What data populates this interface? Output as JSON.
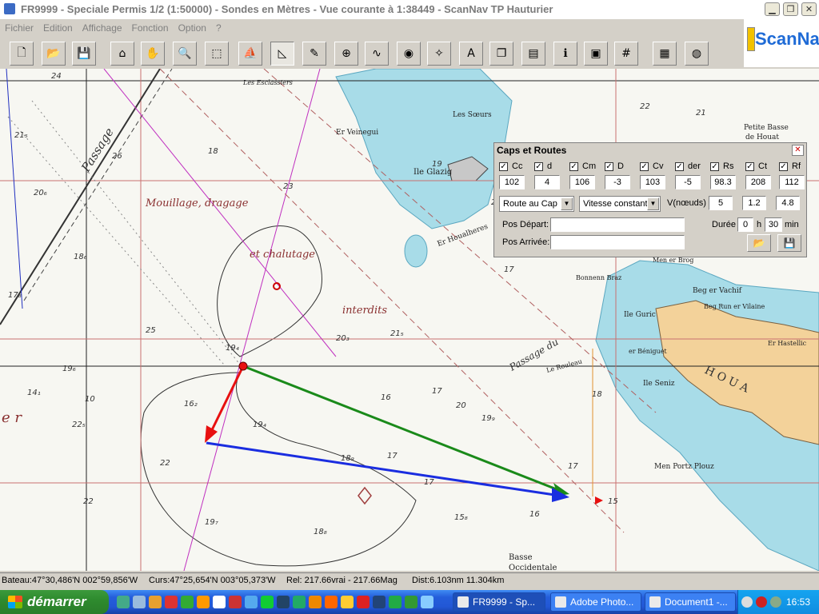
{
  "window": {
    "title": "FR9999 - Speciale Permis 1/2 (1:50000) - Sondes en  Mètres  - Vue courante à 1:38449 - ScanNav TP Hauturier",
    "buttons": [
      "minimize-icon",
      "restore-icon",
      "close-icon"
    ]
  },
  "menu": [
    "Fichier",
    "Edition",
    "Affichage",
    "Fonction",
    "Option",
    "?"
  ],
  "logo": "ScanNav",
  "toolbar": [
    {
      "name": "new-file-icon",
      "glyph": "🗋"
    },
    {
      "name": "open-folder-icon",
      "glyph": "📂"
    },
    {
      "name": "save-icon",
      "glyph": "💾"
    },
    {
      "name": "home-icon",
      "glyph": "⌂"
    },
    {
      "name": "hand-pan-icon",
      "glyph": "✋"
    },
    {
      "name": "zoom-icon",
      "glyph": "🔍"
    },
    {
      "name": "select-rect-icon",
      "glyph": "⬚"
    },
    {
      "name": "boat-icon",
      "glyph": "⛵"
    },
    {
      "name": "triangle-route-icon",
      "glyph": "◺"
    },
    {
      "name": "pencil-line-icon",
      "glyph": "✎"
    },
    {
      "name": "crosshair-icon",
      "glyph": "⊕"
    },
    {
      "name": "route-points-icon",
      "glyph": "∿"
    },
    {
      "name": "palette-icon",
      "glyph": "◉"
    },
    {
      "name": "track-icon",
      "glyph": "✧"
    },
    {
      "name": "text-icon",
      "glyph": "A"
    },
    {
      "name": "windows-icon",
      "glyph": "❐"
    },
    {
      "name": "book-icon",
      "glyph": "▤"
    },
    {
      "name": "info-icon",
      "glyph": "ℹ"
    },
    {
      "name": "chart-image-icon",
      "glyph": "▣"
    },
    {
      "name": "grid-icon",
      "glyph": "#"
    },
    {
      "name": "gps-device-icon",
      "glyph": "▦"
    },
    {
      "name": "compass-icon",
      "glyph": "◍"
    }
  ],
  "chart_labels": {
    "passage_nw": "Passage",
    "mouillage": "Mouillage, dragage",
    "chalutage": "et chalutage",
    "interdits": "interdits",
    "ile_glazig": "Ile Glazig",
    "les_soeurs": "Les Sœurs",
    "er_veinegui": "Er Veinegui",
    "er_houalheres": "Er Houalheres",
    "passage_du": "Passage du",
    "petite_basse": "Petite Basse",
    "de_houat": "de Houat",
    "men_er_brog": "Men er Brog",
    "bonnenn_braz": "Bonnenn Braz",
    "beg_er_vachif": "Beg er Vachif",
    "beg_run": "Beg Run er Vilaine",
    "ile_guric": "Ile Guric",
    "er_beniguet": "er Béniguet",
    "er_hastellic": "Er Hastellic",
    "ile_seniz": "Ile Seniz",
    "le_rouleau": "Le Rouleau",
    "houat": "H O U A",
    "men_portz": "Men Portz Plouz",
    "basse": "Basse",
    "occidentale": "Occidentale",
    "les_esclassiers": "Les Esclassiers",
    "er": "e r",
    "soundings": [
      "24",
      "21₅",
      "26",
      "20₆",
      "18₆",
      "17₈",
      "18",
      "17",
      "16",
      "20₃",
      "21₅",
      "23",
      "25",
      "19₄",
      "19₆",
      "14₁",
      "10",
      "16₂",
      "19₄",
      "22₅",
      "20",
      "22",
      "18₉",
      "19₇",
      "18₈",
      "17",
      "19₉",
      "15₈",
      "22",
      "17",
      "15",
      "16",
      "17",
      "17",
      "18",
      "19",
      "20",
      "21",
      "22"
    ]
  },
  "dialog": {
    "title": "Caps et Routes",
    "fields": [
      {
        "label": "Cc",
        "value": "102"
      },
      {
        "label": "d",
        "value": "4"
      },
      {
        "label": "Cm",
        "value": "106"
      },
      {
        "label": "D",
        "value": "-3"
      },
      {
        "label": "Cv",
        "value": "103"
      },
      {
        "label": "der",
        "value": "-5"
      },
      {
        "label": "Rs",
        "value": "98.3"
      },
      {
        "label": "Ct",
        "value": "208"
      },
      {
        "label": "Rf",
        "value": "112"
      }
    ],
    "route_mode": "Route au Cap",
    "speed_mode": "Vitesse constant",
    "speed_label": "V(nœuds)",
    "speed_value": "5",
    "val_1_2": "1.2",
    "val_4_8": "4.8",
    "pos_depart_label": "Pos Départ:",
    "pos_arrivee_label": "Pos Arrivée:",
    "duree_label": "Durée",
    "duree_h": "0",
    "h_label": "h",
    "duree_min": "30",
    "min_label": "min"
  },
  "status": {
    "bateau": "Bateau:47°30,486'N 002°59,856'W",
    "curs": "Curs:47°25,654'N 003°05,373'W",
    "rel": "Rel: 217.66vrai - 217.66Mag",
    "dist": "Dist:6.103nm  11.304km"
  },
  "taskbar": {
    "start": "démarrer",
    "tasks": [
      "FR9999 - Sp...",
      "Adobe Photo...",
      "Document1 -..."
    ],
    "clock": "16:53"
  },
  "colors": {
    "water_light": "#a8dce8",
    "land": "#f3d29a",
    "route_green": "#1a8a1a",
    "route_red": "#e81010",
    "route_blue": "#1a2de0"
  }
}
